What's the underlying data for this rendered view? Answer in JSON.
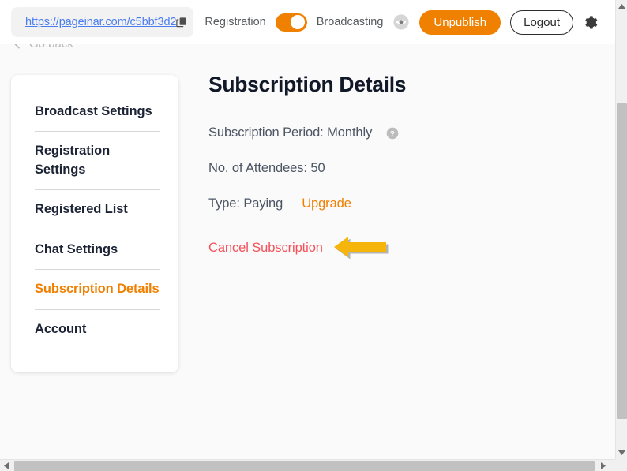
{
  "topbar": {
    "url": "https://pageinar.com/c5bbf3d2",
    "copy_icon": "copy-icon",
    "registration_label": "Registration",
    "registration_toggle_on": true,
    "broadcasting_label": "Broadcasting",
    "preview_icon": "eye-icon",
    "unpublish_label": "Unpublish",
    "logout_label": "Logout",
    "settings_icon": "gear-icon",
    "accent_color": "#f08000",
    "link_color": "#4a7df0"
  },
  "go_back": {
    "label": "Go back",
    "icon": "arrow-left-icon"
  },
  "sidebar": {
    "items": [
      {
        "label": "Broadcast Settings",
        "active": false
      },
      {
        "label": "Registration Settings",
        "active": false
      },
      {
        "label": "Registered List",
        "active": false
      },
      {
        "label": "Chat Settings",
        "active": false
      },
      {
        "label": "Subscription Details",
        "active": true
      },
      {
        "label": "Account",
        "active": false
      }
    ]
  },
  "main": {
    "title": "Subscription Details",
    "subscription_period": "Subscription Period: Monthly",
    "help_icon": "question-mark-icon",
    "attendees": "No. of Attendees: 50",
    "type": "Type: Paying",
    "upgrade_label": "Upgrade",
    "cancel_label": "Cancel Subscription",
    "cancel_color": "#f4525a",
    "annotation_arrow_color": "#f5b50a"
  },
  "scrollbars": {
    "vertical_present": true,
    "horizontal_present": true
  }
}
